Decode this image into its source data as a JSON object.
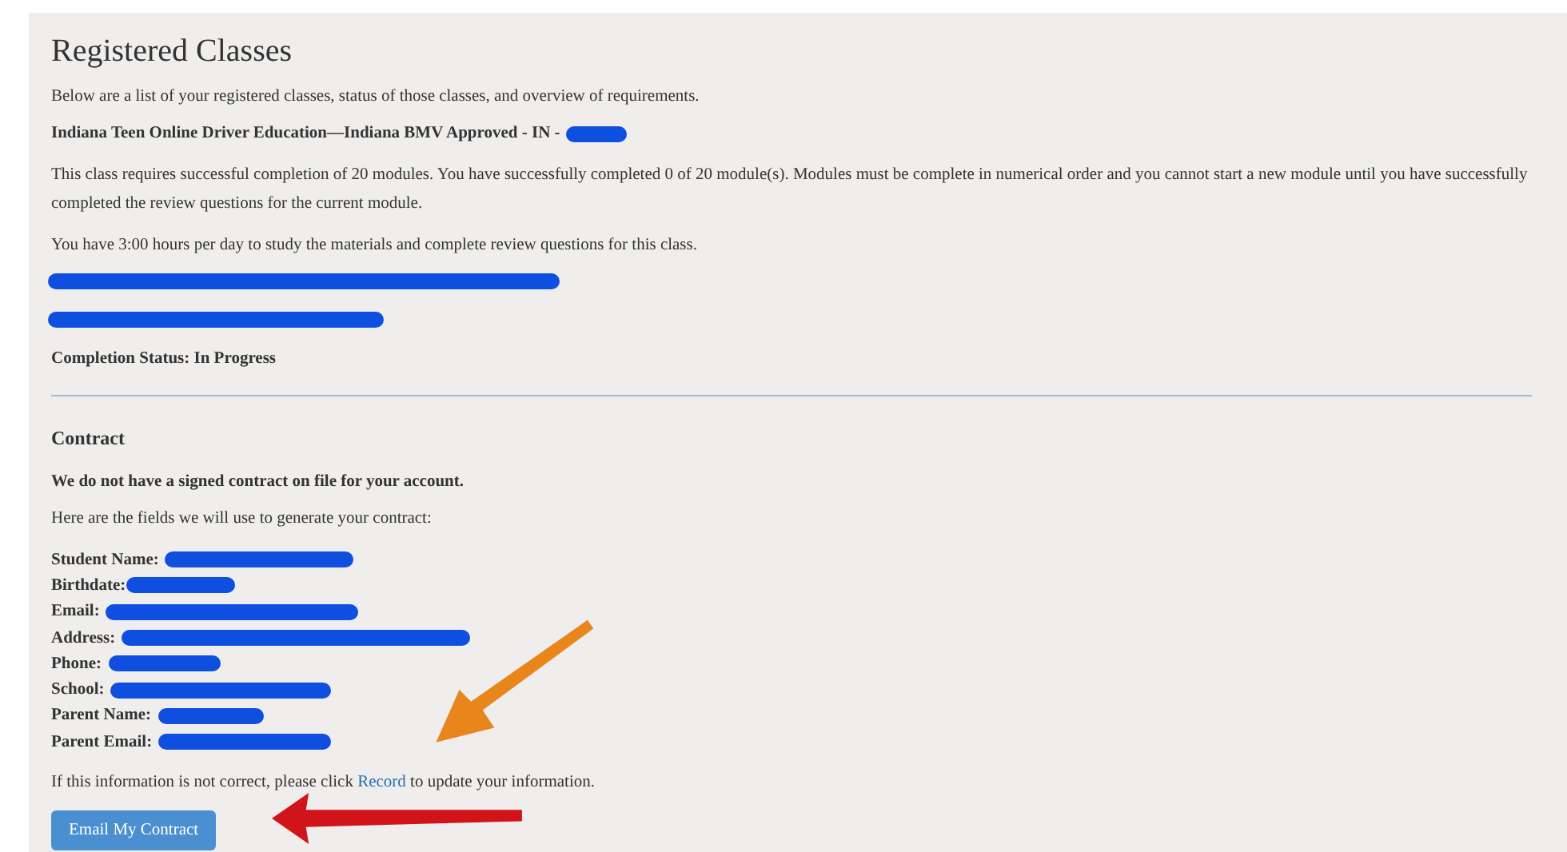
{
  "title": "Registered Classes",
  "intro": "Below are a list of your registered classes, status of those classes, and overview of requirements.",
  "class": {
    "name": "Indiana Teen Online Driver Education—Indiana BMV Approved - IN -",
    "requirements": "This class requires successful completion of 20 modules. You have successfully completed 0 of 20 module(s). Modules must be complete in numerical order and you cannot start a new module until you have successfully completed the review questions for the current module.",
    "hours": "You have 3:00 hours per day to study the materials and complete review questions for this class.",
    "status": "Completion Status: In Progress"
  },
  "contract": {
    "heading": "Contract",
    "notice": "We do not have a signed contract on file for your account.",
    "lead": "Here are the fields we will use to generate your contract:",
    "fields": [
      {
        "label": "Student Name:"
      },
      {
        "label": "Birthdate:"
      },
      {
        "label": "Email:"
      },
      {
        "label": "Address:"
      },
      {
        "label": "Phone:"
      },
      {
        "label": "School:"
      },
      {
        "label": "Parent Name:"
      },
      {
        "label": "Parent Email:"
      }
    ],
    "note_before": "If this information is not correct, please click",
    "note_link": "Record",
    "note_after": "to update your information.",
    "button": "Email My Contract"
  }
}
